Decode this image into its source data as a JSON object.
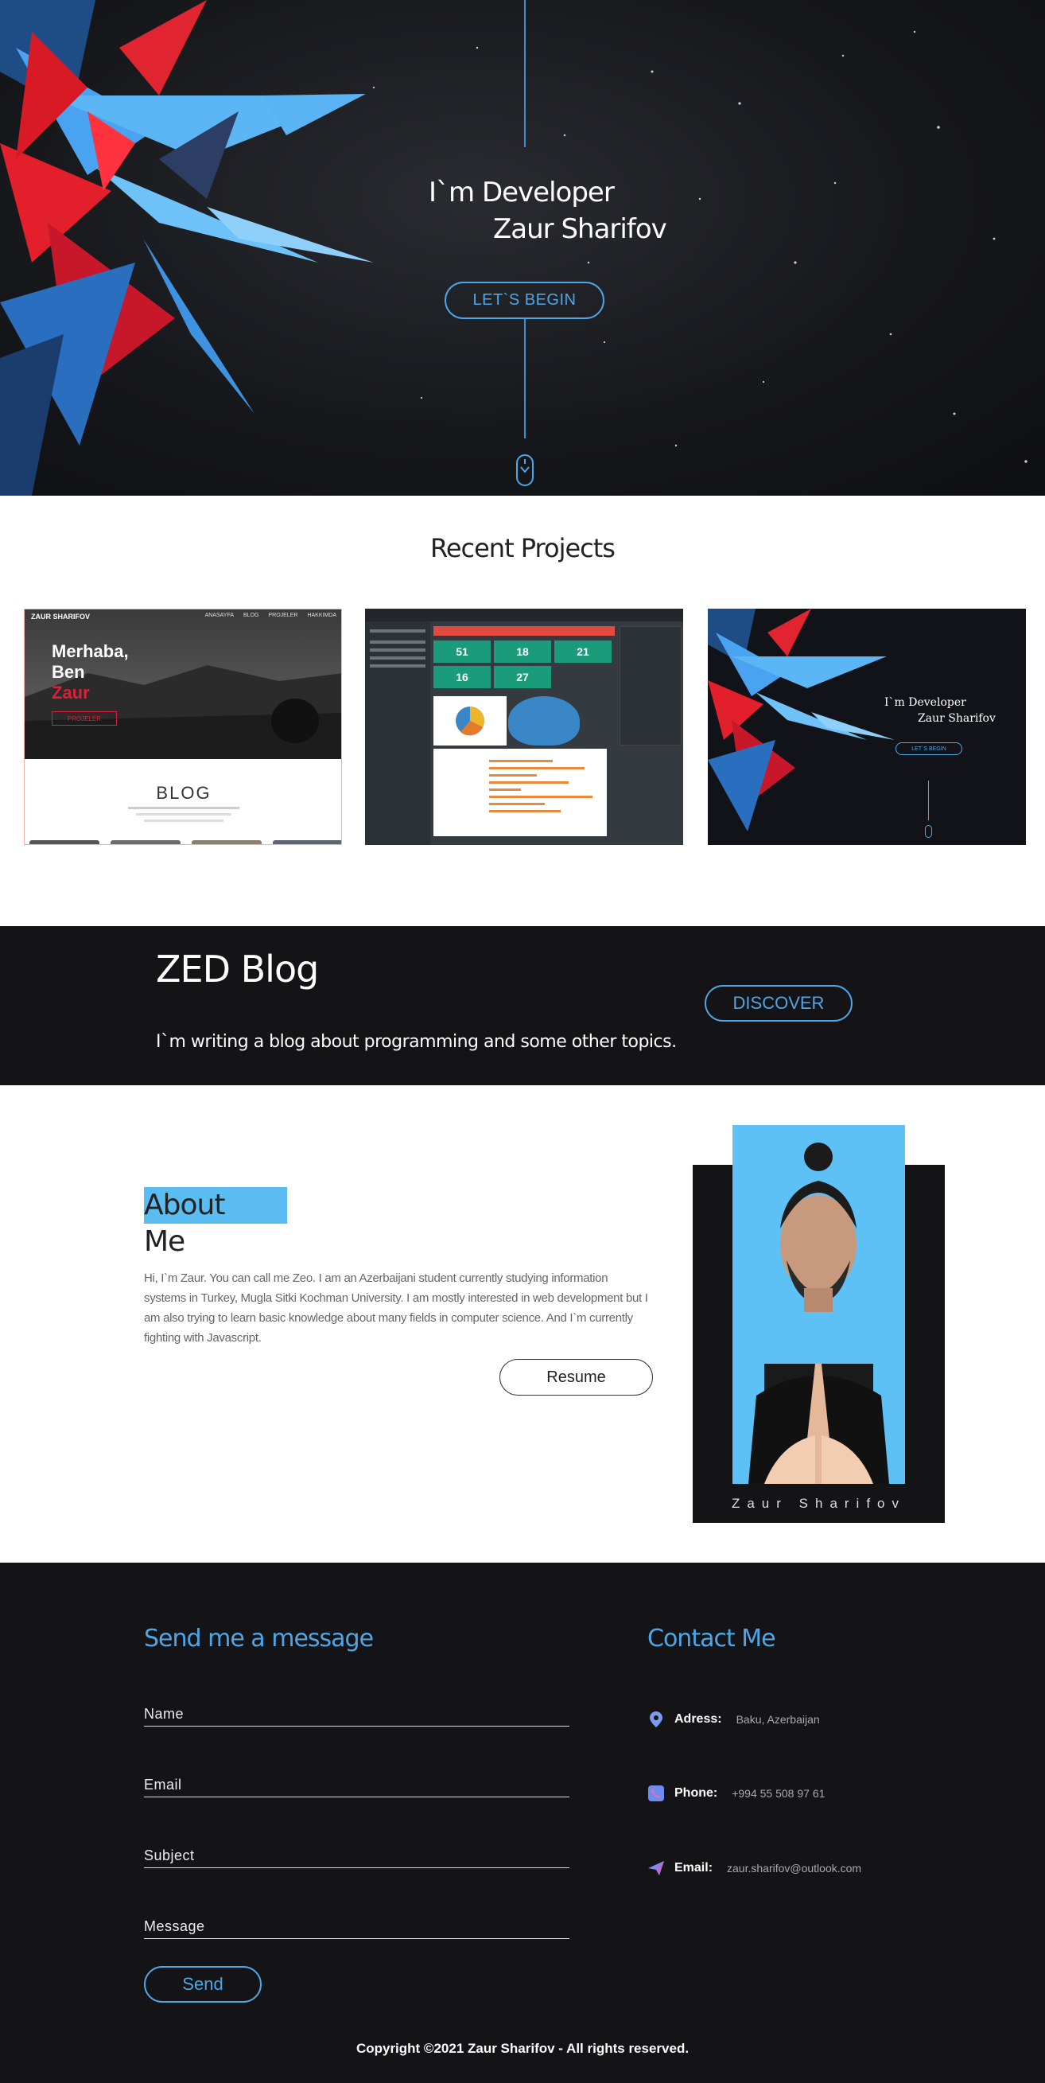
{
  "hero": {
    "title": "I`m Developer",
    "name": "Zaur Sharifov",
    "cta": "LET`S BEGIN"
  },
  "projects": {
    "heading": "Recent Projects",
    "items": [
      {
        "nav_logo": "ZAUR SHARIFOV",
        "nav_links": [
          "ANASAYFA",
          "BLOG",
          "PROJELER",
          "HAKKIMDA"
        ],
        "greeting_1": "Merhaba,",
        "greeting_2": "Ben",
        "greeting_3": "Zaur",
        "button": "PROJELER",
        "section": "BLOG"
      },
      {
        "stats": [
          "51",
          "18",
          "21",
          "16",
          "27"
        ]
      },
      {
        "title": "I`m Developer",
        "name": "Zaur Sharifov",
        "cta": "LET`S BEGIN"
      }
    ]
  },
  "blog": {
    "title": "ZED Blog",
    "subtitle": "I`m writing a blog about programming and some other topics.",
    "cta": "DISCOVER"
  },
  "about": {
    "title": "About Me",
    "text": "Hi, I`m Zaur. You can call me Zeo. I am an Azerbaijani student currently studying information systems in Turkey, Mugla Sitki Kochman University. I am mostly interested in web development but I am also trying to learn basic knowledge about many fields in computer science. And I`m currently fighting with Javascript.",
    "resume": "Resume",
    "caption": "Zaur Sharifov"
  },
  "contact": {
    "form_title": "Send me a message",
    "fields": [
      "Name",
      "Email",
      "Subject",
      "Message"
    ],
    "send": "Send",
    "info_title": "Contact Me",
    "info": [
      {
        "icon": "location-pin-icon",
        "label": "Adress:",
        "value": "Baku, Azerbaijan"
      },
      {
        "icon": "phone-icon",
        "label": "Phone:",
        "value": "+994 55 508 97 61"
      },
      {
        "icon": "paper-plane-icon",
        "label": "Email:",
        "value": "zaur.sharifov@outlook.com"
      }
    ],
    "copyright": "Copyright ©2021 Zaur Sharifov - All rights reserved."
  },
  "colors": {
    "accent": "#4ea6e8",
    "about_highlight": "#5bbcf2",
    "dark_bg": "#141416"
  }
}
